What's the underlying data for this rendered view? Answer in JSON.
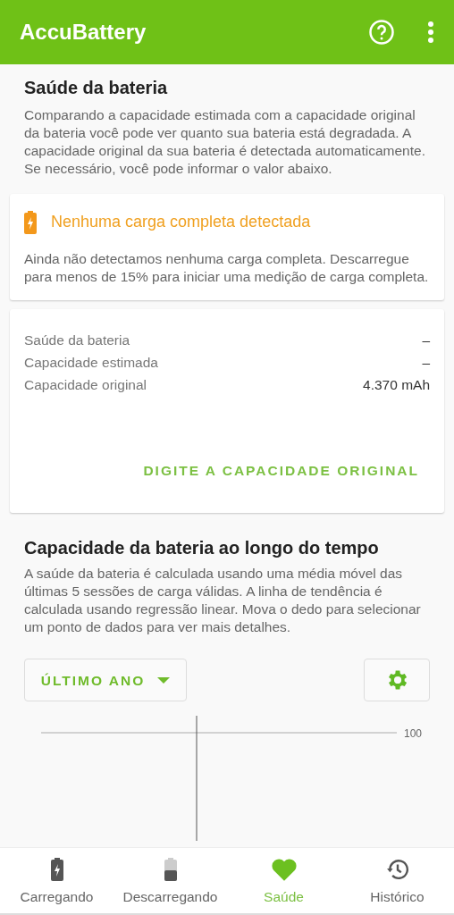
{
  "app_bar": {
    "title": "AccuBattery"
  },
  "health": {
    "title": "Saúde da bateria",
    "description": "Comparando a capacidade estimada com a capacidade original da bateria você pode ver quanto sua bateria está degradada. A capacidade original da sua bateria é detectada automaticamente. Se necessário, você pode informar o valor abaixo."
  },
  "alert_card": {
    "title": "Nenhuma carga completa detectada",
    "message": "Ainda não detectamos nenhuma carga completa. Descarregue para menos de 15% para iniciar uma medição de carga completa."
  },
  "stats_card": {
    "rows": [
      {
        "label": "Saúde da bateria",
        "value": "–"
      },
      {
        "label": "Capacidade estimada",
        "value": "–"
      },
      {
        "label": "Capacidade original",
        "value": "4.370 mAh"
      }
    ],
    "action": "DIGITE A CAPACIDADE ORIGINAL"
  },
  "capacity_section": {
    "title": "Capacidade da bateria ao longo do tempo",
    "description": "A saúde da bateria é calculada usando uma média móvel das últimas 5 sessões de carga válidas. A linha de tendência é calculada usando regressão linear. Mova o dedo para selecionar um ponto de dados para ver mais detalhes.",
    "period": "ÚLTIMO ANO",
    "chart_tick": "100"
  },
  "bottom_nav": [
    {
      "kind": "charging",
      "label": "Carregando",
      "selected": false
    },
    {
      "kind": "discharging",
      "label": "Descarregando",
      "selected": false
    },
    {
      "kind": "health",
      "label": "Saúde",
      "selected": true
    },
    {
      "kind": "history",
      "label": "Histórico",
      "selected": false
    }
  ]
}
